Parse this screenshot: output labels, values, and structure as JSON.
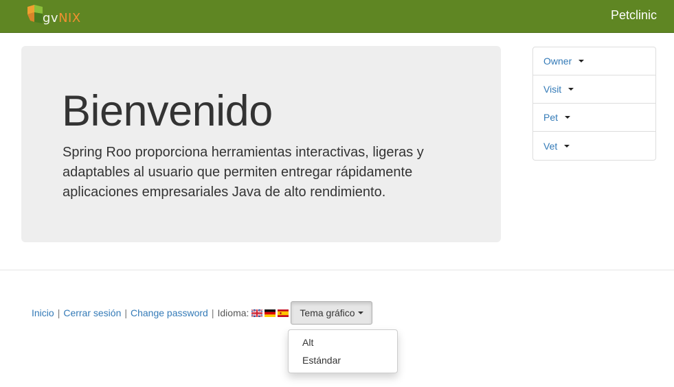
{
  "navbar": {
    "logo_text_gv": "gv",
    "logo_text_nix": "NIX",
    "brand": "Petclinic"
  },
  "jumbotron": {
    "title": "Bienvenido",
    "text": "Spring Roo proporciona herramientas interactivas, ligeras y adaptables al usuario que permiten entregar rápidamente aplicaciones empresariales Java de alto rendimiento."
  },
  "menu": {
    "items": [
      {
        "label": "Owner"
      },
      {
        "label": "Visit"
      },
      {
        "label": "Pet"
      },
      {
        "label": "Vet"
      }
    ]
  },
  "footer": {
    "home": "Inicio",
    "logout": "Cerrar sesión",
    "change_password": "Change password",
    "language_label": "Idioma:",
    "separator": "|",
    "flags": [
      "uk-flag-icon",
      "german-flag-icon",
      "spanish-flag-icon"
    ],
    "theme_button": "Tema gráfico"
  },
  "theme_dropdown": {
    "options": [
      "Alt",
      "Estándar"
    ]
  },
  "colors": {
    "navbar": "#5f8623",
    "link": "#337ab7",
    "jumbotron_bg": "#eeeeee"
  }
}
